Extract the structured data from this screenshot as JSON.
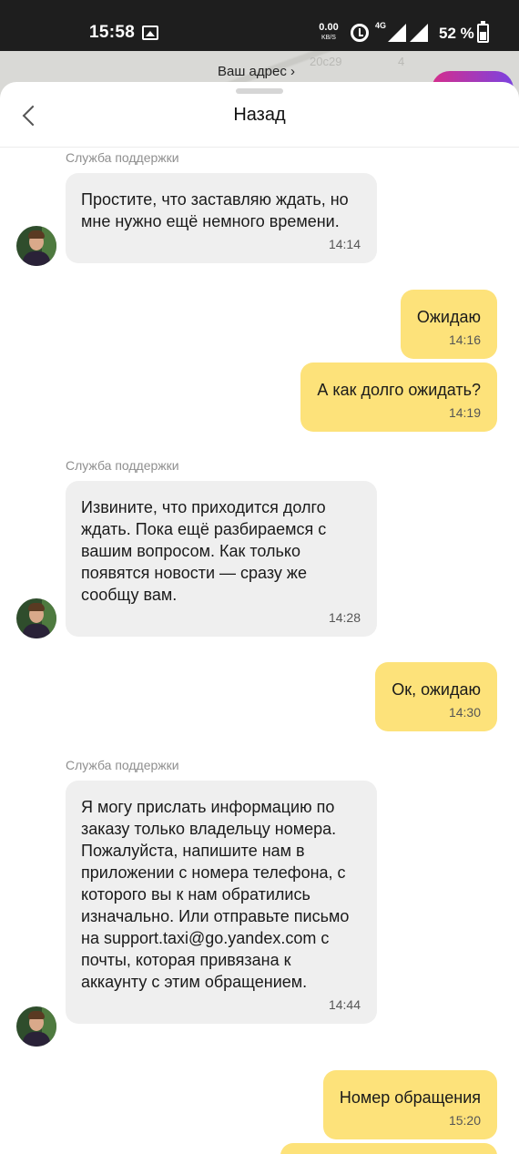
{
  "status_bar": {
    "time": "15:58",
    "speed_value": "0.00",
    "speed_unit": "KB/S",
    "network": "4G",
    "battery": "52 %"
  },
  "peek": {
    "address": "Ваш адрес ›",
    "faint_text": "20с29",
    "faint_text2": "4"
  },
  "header": {
    "title": "Назад"
  },
  "messages": [
    {
      "direction": "in",
      "sender": "Служба поддержки",
      "text": "Простите, что заставляю ждать, но мне нужно ещё немного времени.",
      "time": "14:14"
    },
    {
      "direction": "out",
      "text": "Ожидаю",
      "time": "14:16"
    },
    {
      "direction": "out",
      "text": "А как долго ожидать?",
      "time": "14:19"
    },
    {
      "direction": "in",
      "sender": "Служба поддержки",
      "text": "Извините, что приходится долго ждать. Пока ещё разбираемся с вашим вопросом. Как только появятся новости — сразу же сообщу вам.",
      "time": "14:28"
    },
    {
      "direction": "out",
      "text": "Ок, ожидаю",
      "time": "14:30"
    },
    {
      "direction": "in",
      "sender": "Служба поддержки",
      "text": "Я могу прислать информацию по заказу только владельцу номера. Пожалуйста, напишите нам в приложении с номера телефона, с которого вы к нам обратились изначально. Или отправьте письмо на support.taxi@go.yandex.com с почты, которая привязана к аккаунту с этим обращением.",
      "time": "14:44"
    },
    {
      "direction": "out",
      "text": "Номер обращения",
      "time": "15:20"
    }
  ]
}
